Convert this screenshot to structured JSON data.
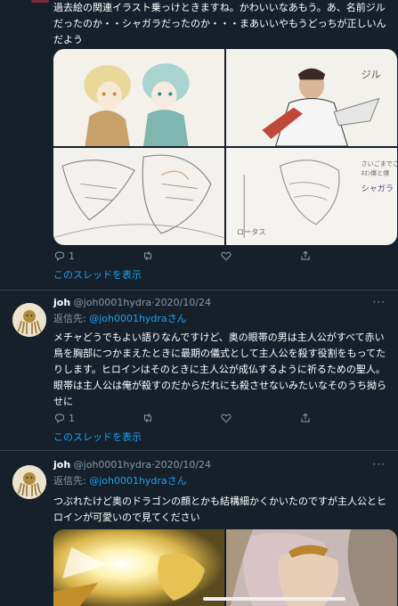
{
  "tweet1": {
    "text_lines": [
      "過去絵の関連イラスト乗っけときますね。かわいいなあもう。あ、名前ジル",
      "だったのか・・シャガラだったのか・・・まあいいやもうどっちが正しいん",
      "だよう"
    ],
    "image_labels": [
      "ジル",
      "シャガラ",
      "ロータス"
    ],
    "reply_count": "1",
    "retweet_count": "",
    "like_count": "",
    "thread_link": "このスレッドを表示"
  },
  "tweet2": {
    "name": "joh",
    "handle": "@joh0001hydra",
    "sep": "·",
    "date": "2020/10/24",
    "reply_to_label": "返信先: ",
    "reply_to_handle": "@joh0001hydra",
    "reply_to_suffix": "さん",
    "text_lines": [
      "メチャどうでもよい語りなんですけど、奥の眼帯の男は主人公がすべて赤い",
      "鳥を胸部につかまえたときに最期の儀式として主人公を殺す役割をもってた",
      "りします。ヒロインはそのときに主人公が成仏するように祈るための聖人。",
      "眼帯は主人公は俺が殺すのだからだれにも殺させないみたいなそのうち拗ら",
      "せに"
    ],
    "reply_count": "1",
    "thread_link": "このスレッドを表示",
    "more": "···"
  },
  "tweet3": {
    "name": "joh",
    "handle": "@joh0001hydra",
    "sep": "·",
    "date": "2020/10/24",
    "reply_to_label": "返信先: ",
    "reply_to_handle": "@joh0001hydra",
    "reply_to_suffix": "さん",
    "text_lines": [
      "つぶれたけど奥のドラゴンの顔とかも結構細かくかいたのですが主人公とヒ",
      "ロインが可愛いので見てください"
    ],
    "more": "···"
  },
  "colors": {
    "background": "#15202b",
    "link": "#1da1f2",
    "secondary": "#8899a6",
    "divider": "#38444d"
  }
}
